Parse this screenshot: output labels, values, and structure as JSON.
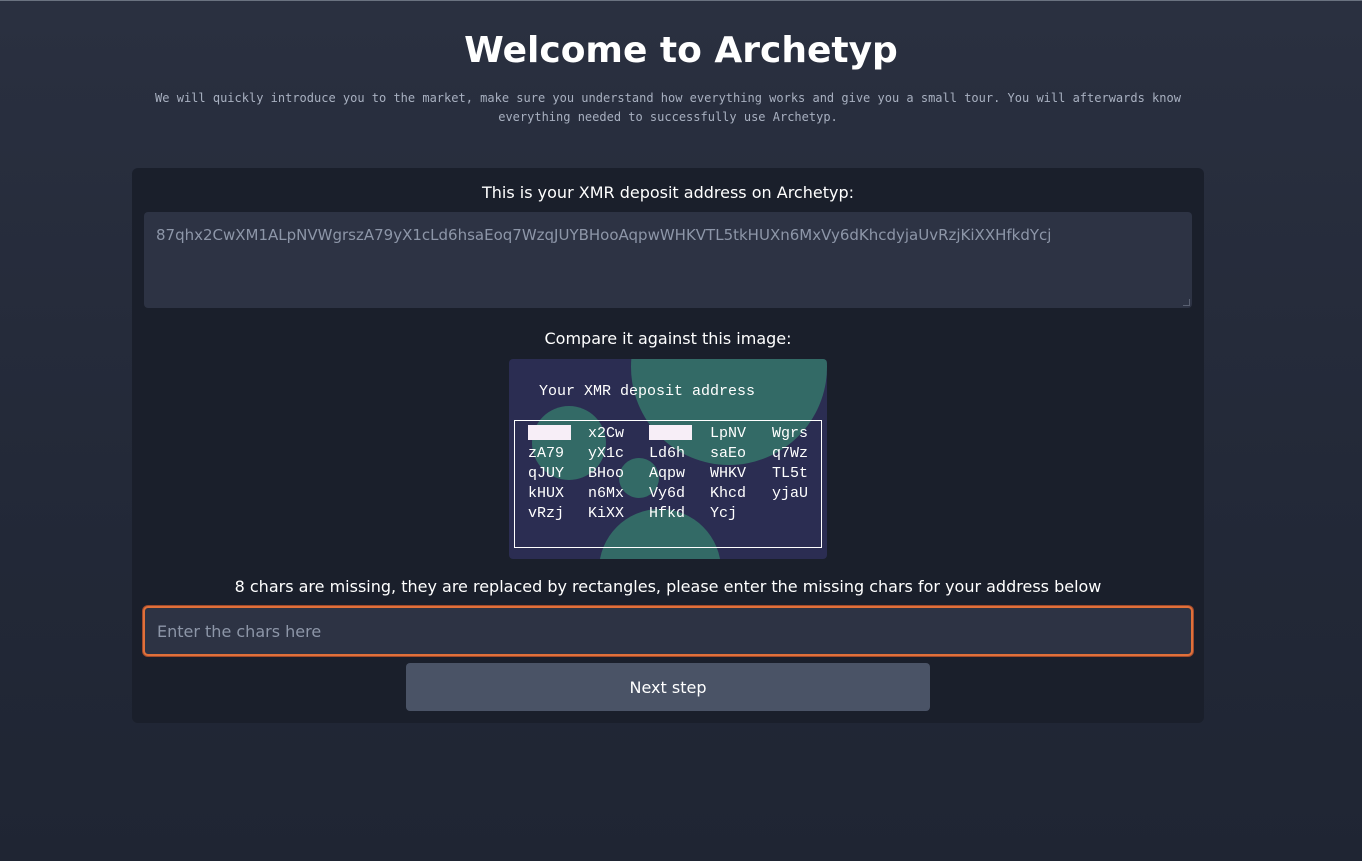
{
  "page": {
    "title": "Welcome to Archetyp",
    "intro": "We will quickly introduce you to the market, make sure you understand how everything works and give you a small tour. You will afterwards know everything needed to successfully use Archetyp."
  },
  "deposit": {
    "label": "This is your XMR deposit address on Archetyp:",
    "address": "87qhx2CwXM1ALpNVWgrszA79yX1cLd6hsaEoq7WzqJUYBHooAqpwWHKVTL5tkHUXn6MxVy6dKhcdyjaUvRzjKiXXHfkdYcj"
  },
  "compare": {
    "label": "Compare it against this image:",
    "image_title": "Your XMR deposit address",
    "chunks": [
      [
        "",
        "x2Cw",
        "",
        "LpNV",
        "Wgrs"
      ],
      [
        "zA79",
        "yX1c",
        "Ld6h",
        "saEo",
        "q7Wz"
      ],
      [
        "qJUY",
        "BHoo",
        "Aqpw",
        "WHKV",
        "TL5t"
      ],
      [
        "kHUX",
        "n6Mx",
        "Vy6d",
        "Khcd",
        "yjaU"
      ],
      [
        "vRzj",
        "KiXX",
        "Hfkd",
        "Ycj",
        ""
      ]
    ]
  },
  "missing": {
    "instruction": "8 chars are missing, they are replaced by rectangles, please enter the missing chars for your address below",
    "placeholder": "Enter the chars here",
    "value": ""
  },
  "next_button": {
    "label": "Next step"
  },
  "colors": {
    "background": "#232938",
    "card": "#1a1f2b",
    "field": "#2d3344",
    "focus_border": "#e0703a",
    "button": "#4a5366",
    "captcha_bg": "#2b2d52",
    "captcha_blob": "#336a66"
  }
}
